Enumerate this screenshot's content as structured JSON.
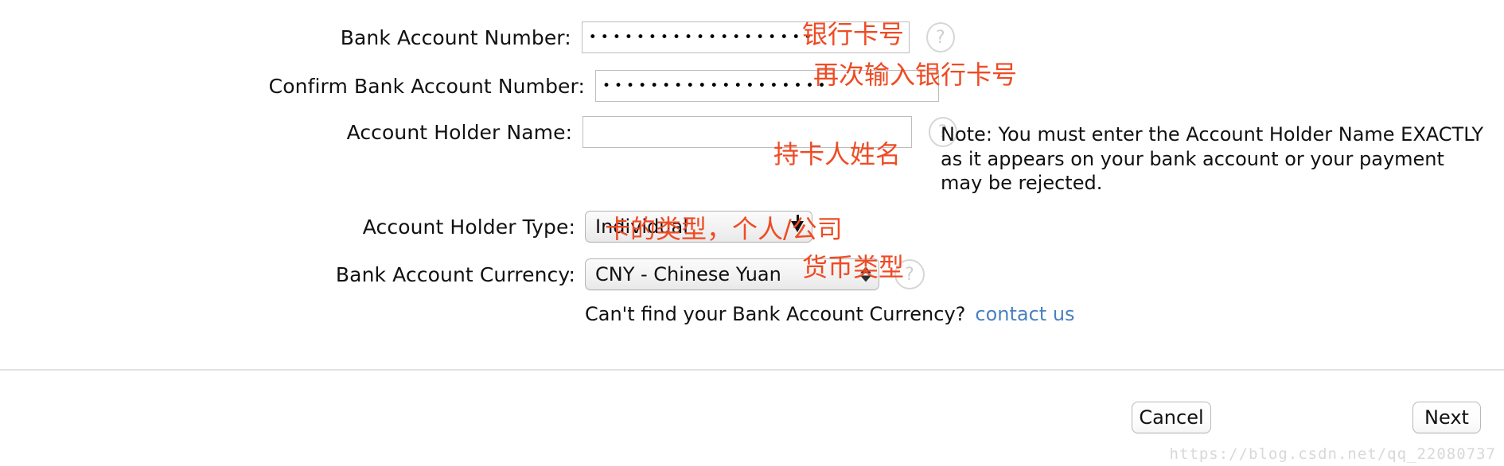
{
  "form": {
    "fields": [
      {
        "label": "Bank Account Number:",
        "value_mask": "•••••••••••••••••••",
        "annotation": "银行卡号",
        "help_icon": "?"
      },
      {
        "label": "Confirm Bank Account Number:",
        "value_mask": "•••••••••••••••••••",
        "annotation": "再次输入银行卡号"
      },
      {
        "label": "Account Holder Name:",
        "value_mask": "",
        "annotation": "持卡人姓名",
        "help_icon": "?"
      },
      {
        "label": "Account Holder Type:",
        "value": "Individual",
        "annotation": "卡的类型，个人/公司"
      },
      {
        "label": "Bank Account Currency:",
        "value": "CNY - Chinese Yuan",
        "annotation": "货币类型",
        "help_icon": "?"
      }
    ],
    "note": "Note: You must enter the Account Holder Name EXACTLY as it appears on your bank account or your payment may be rejected.",
    "currency_help": {
      "text": "Can't find your Bank Account Currency?",
      "link_label": "contact us"
    }
  },
  "footer": {
    "cancel_label": "Cancel",
    "next_label": "Next"
  },
  "watermark": "https://blog.csdn.net/qq_22080737",
  "colors": {
    "annotation": "#ef4b24",
    "link": "#4a80c0",
    "divider": "#e2e2e2"
  }
}
